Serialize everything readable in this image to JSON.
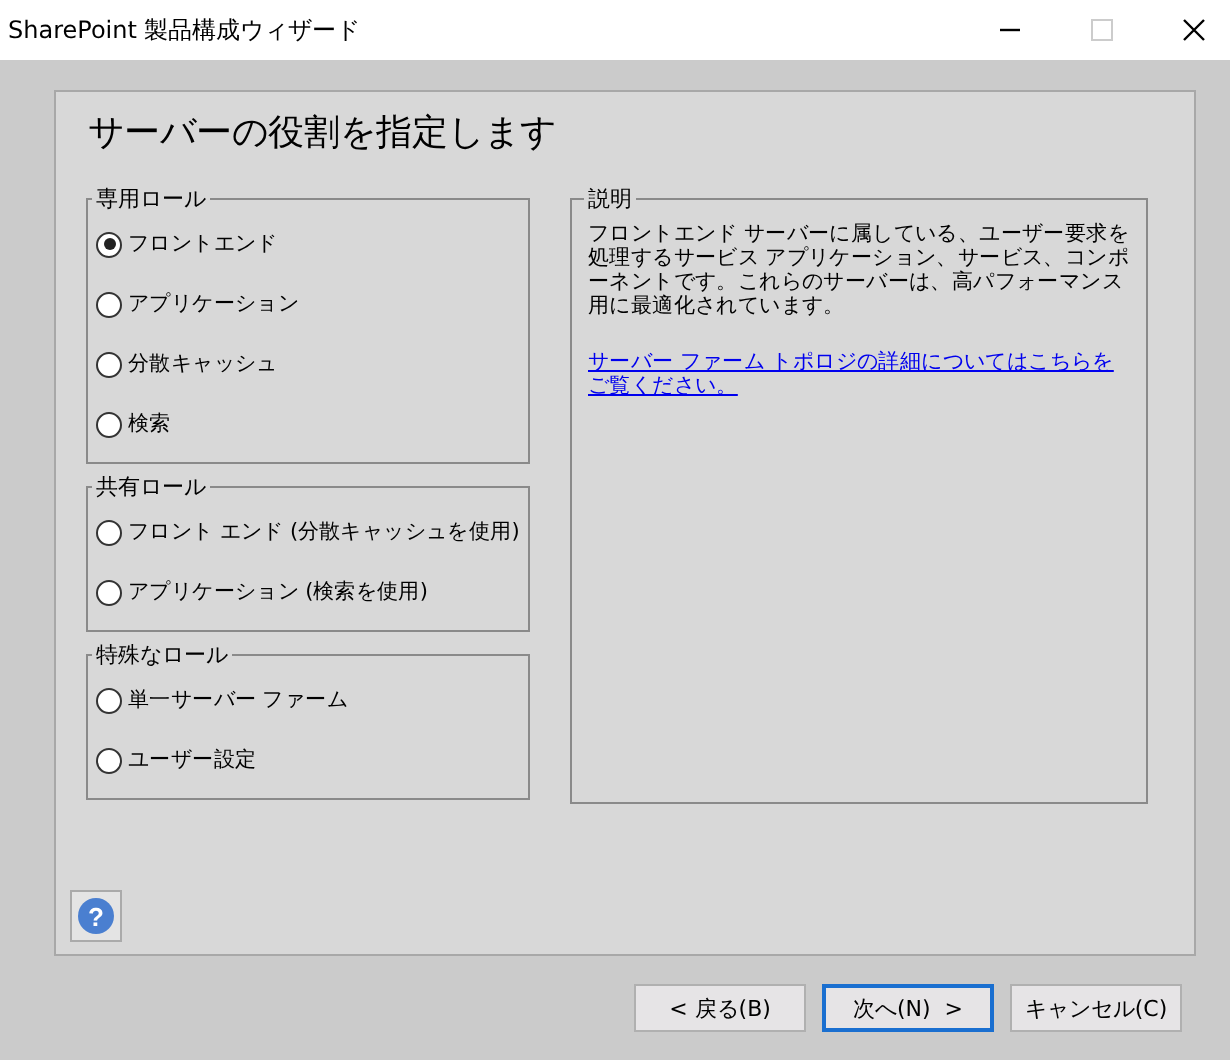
{
  "window": {
    "title": "SharePoint 製品構成ウィザード",
    "maximize_disabled": true
  },
  "heading": "サーバーの役割を指定します",
  "groups": [
    {
      "title": "専用ロール",
      "options": [
        {
          "label": "フロントエンド",
          "selected": true
        },
        {
          "label": "アプリケーション",
          "selected": false
        },
        {
          "label": "分散キャッシュ",
          "selected": false
        },
        {
          "label": "検索",
          "selected": false
        }
      ]
    },
    {
      "title": "共有ロール",
      "options": [
        {
          "label": "フロント エンド (分散キャッシュを使用)",
          "selected": false
        },
        {
          "label": "アプリケーション (検索を使用)",
          "selected": false
        }
      ]
    },
    {
      "title": "特殊なロール",
      "options": [
        {
          "label": "単一サーバー ファーム",
          "selected": false
        },
        {
          "label": "ユーザー設定",
          "selected": false
        }
      ]
    }
  ],
  "description": {
    "title": "説明",
    "text": "フロントエンド サーバーに属している、ユーザー要求を処理するサービス アプリケーション、サービス、コンポーネントです。これらのサーバーは、高パフォーマンス用に最適化されています。",
    "link": "サーバー ファーム トポロジの詳細についてはこちらをご覧ください。"
  },
  "help_button": "?",
  "buttons": [
    {
      "label": "< 戻る(B)",
      "default": false
    },
    {
      "label": "次へ(N)  >",
      "default": true
    },
    {
      "label": "キャンセル(C)",
      "default": false
    }
  ]
}
